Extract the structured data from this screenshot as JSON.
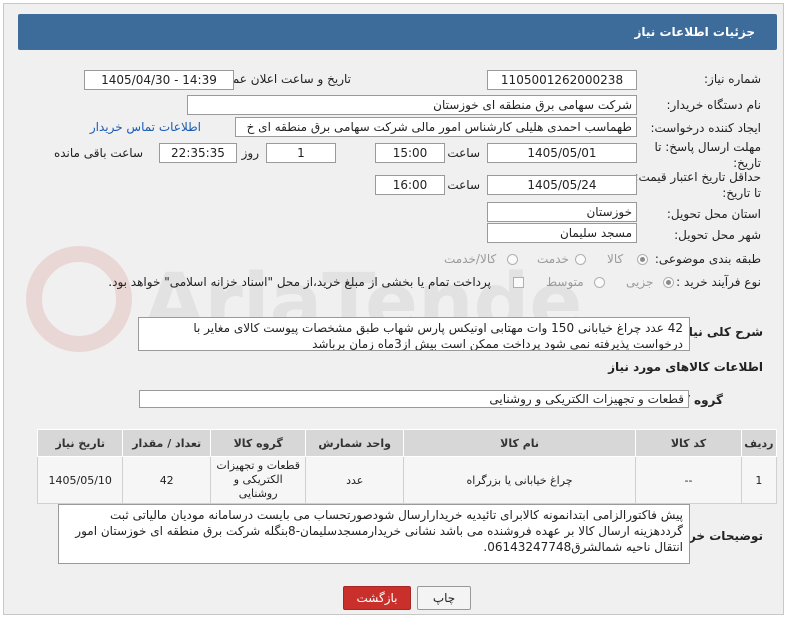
{
  "header": {
    "title": "جزئیات اطلاعات نیاز"
  },
  "fields": {
    "need_number_label": "شماره نیاز:",
    "need_number": "1105001262000238",
    "announce_label": "تاریخ و ساعت اعلان عمومی:",
    "announce_value": "1405/04/30 - 14:39",
    "buyer_org_label": "نام دستگاه خریدار:",
    "buyer_org": "شرکت سهامی برق منطقه ای خوزستان",
    "creator_label": "ایجاد کننده درخواست:",
    "creator": "طهماسب احمدی هلیلی کارشناس امور مالی شرکت سهامی برق منطقه ای خ",
    "contact_link": "اطلاعات تماس خریدار",
    "reply_deadline_label": "مهلت ارسال پاسخ: تا تاریخ:",
    "reply_date": "1405/05/01",
    "time_label": "ساعت",
    "reply_time": "15:00",
    "days_value": "1",
    "days_label": "روز و",
    "remaining_time": "22:35:35",
    "remaining_label": "ساعت باقی مانده",
    "validity_label": "حداقل تاریخ اعتبار قیمت: تا تاریخ:",
    "validity_date": "1405/05/24",
    "validity_time": "16:00",
    "province_label": "استان محل تحویل:",
    "province": "خوزستان",
    "city_label": "شهر محل تحویل:",
    "city": "مسجد سلیمان",
    "category_label": "طبقه بندی موضوعی:",
    "category_options": [
      "کالا",
      "خدمت",
      "کالا/خدمت"
    ],
    "process_label": "نوع فرآیند خرید :",
    "process_options": [
      "جزیی",
      "متوسط"
    ],
    "payment_note": "پرداخت تمام یا بخشی از مبلغ خرید،از محل \"اسناد خزانه اسلامی\" خواهد بود."
  },
  "summary": {
    "label": "شرح کلی نیاز:",
    "text": "42 عدد چراغ خیابانی 150 وات مهتابی اونیکس پارس شهاب طبق مشخصات پیوست  کالای مغایر با درخواست پذیرفته نمی شود پرداخت ممکن است بیش از3ماه زمان برباشد"
  },
  "goods": {
    "section_title": "اطلاعات کالاهای مورد نیاز",
    "group_label": "گروه کالا:",
    "group_value": "قطعات و تجهیزات الکتریکی و روشنایی",
    "columns": [
      "ردیف",
      "کد کالا",
      "نام کالا",
      "واحد شمارش",
      "گروه کالا",
      "تعداد / مقدار",
      "تاریخ نیاز"
    ],
    "rows": [
      {
        "row": "1",
        "code": "--",
        "name": "چراغ خیابانی یا بزرگراه",
        "unit": "عدد",
        "group": "قطعات و تجهیزات الکتریکی و روشنایی",
        "qty": "42",
        "date": "1405/05/10"
      }
    ]
  },
  "buyer_notes": {
    "label": "توضیحات خریدار:",
    "text": "پیش فاکتورالزامی ابتدانمونه کالابرای تائیدیه خریدارارسال شودصورتحساب می بایست درسامانه مودیان مالیاتی ثبت گرددهزینه ارسال کالا بر عهده فروشنده می باشد نشانی خریدارمسجدسلیمان-8بنگله شرکت برق منطقه ای خوزستان امور انتقال ناحیه شمالشرق06143247748."
  },
  "buttons": {
    "print": "چاپ",
    "back": "بازگشت"
  },
  "watermark": {
    "text": "AriaTender.net"
  },
  "colors": {
    "header_bg": "#3d6c9b",
    "back_button": "#c9302c",
    "link": "#1c5bb3"
  }
}
